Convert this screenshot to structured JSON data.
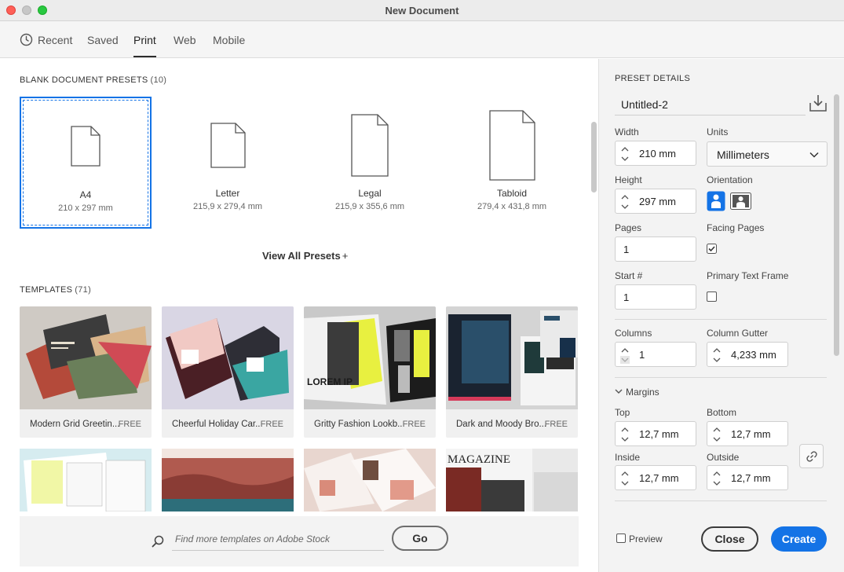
{
  "window": {
    "title": "New Document"
  },
  "tabs": [
    {
      "label": "Recent"
    },
    {
      "label": "Saved"
    },
    {
      "label": "Print"
    },
    {
      "label": "Web"
    },
    {
      "label": "Mobile"
    }
  ],
  "blank_presets": {
    "heading": "BLANK DOCUMENT PRESETS",
    "count": "(10)",
    "items": [
      {
        "name": "A4",
        "size": "210 x 297 mm"
      },
      {
        "name": "Letter",
        "size": "215,9 x 279,4 mm"
      },
      {
        "name": "Legal",
        "size": "215,9 x 355,6 mm"
      },
      {
        "name": "Tabloid",
        "size": "279,4 x 431,8 mm"
      }
    ],
    "view_all": "View All Presets"
  },
  "templates": {
    "heading": "TEMPLATES",
    "count": "(71)",
    "items": [
      {
        "name": "Modern Grid Greetin...",
        "badge": "FREE"
      },
      {
        "name": "Cheerful Holiday Car...",
        "badge": "FREE"
      },
      {
        "name": "Gritty Fashion Lookb...",
        "badge": "FREE"
      },
      {
        "name": "Dark and Moody Bro...",
        "badge": "FREE"
      }
    ],
    "thumb_text": {
      "gritty": "LOREM IP",
      "magazine": "MAGAZINE"
    }
  },
  "search": {
    "placeholder": "Find more templates on Adobe Stock",
    "go_label": "Go"
  },
  "preset_details": {
    "heading": "PRESET DETAILS",
    "name": "Untitled-2",
    "width_label": "Width",
    "width_value": "210 mm",
    "units_label": "Units",
    "units_value": "Millimeters",
    "height_label": "Height",
    "height_value": "297 mm",
    "orientation_label": "Orientation",
    "pages_label": "Pages",
    "pages_value": "1",
    "facing_label": "Facing Pages",
    "start_label": "Start #",
    "start_value": "1",
    "primary_label": "Primary Text Frame",
    "columns_label": "Columns",
    "columns_value": "1",
    "gutter_label": "Column Gutter",
    "gutter_value": "4,233 mm",
    "margins_label": "Margins",
    "top_label": "Top",
    "top_value": "12,7 mm",
    "bottom_label": "Bottom",
    "bottom_value": "12,7 mm",
    "inside_label": "Inside",
    "inside_value": "12,7 mm",
    "outside_label": "Outside",
    "outside_value": "12,7 mm"
  },
  "footer": {
    "preview_label": "Preview",
    "close_label": "Close",
    "create_label": "Create"
  },
  "colors": {
    "accent": "#1473e6"
  }
}
